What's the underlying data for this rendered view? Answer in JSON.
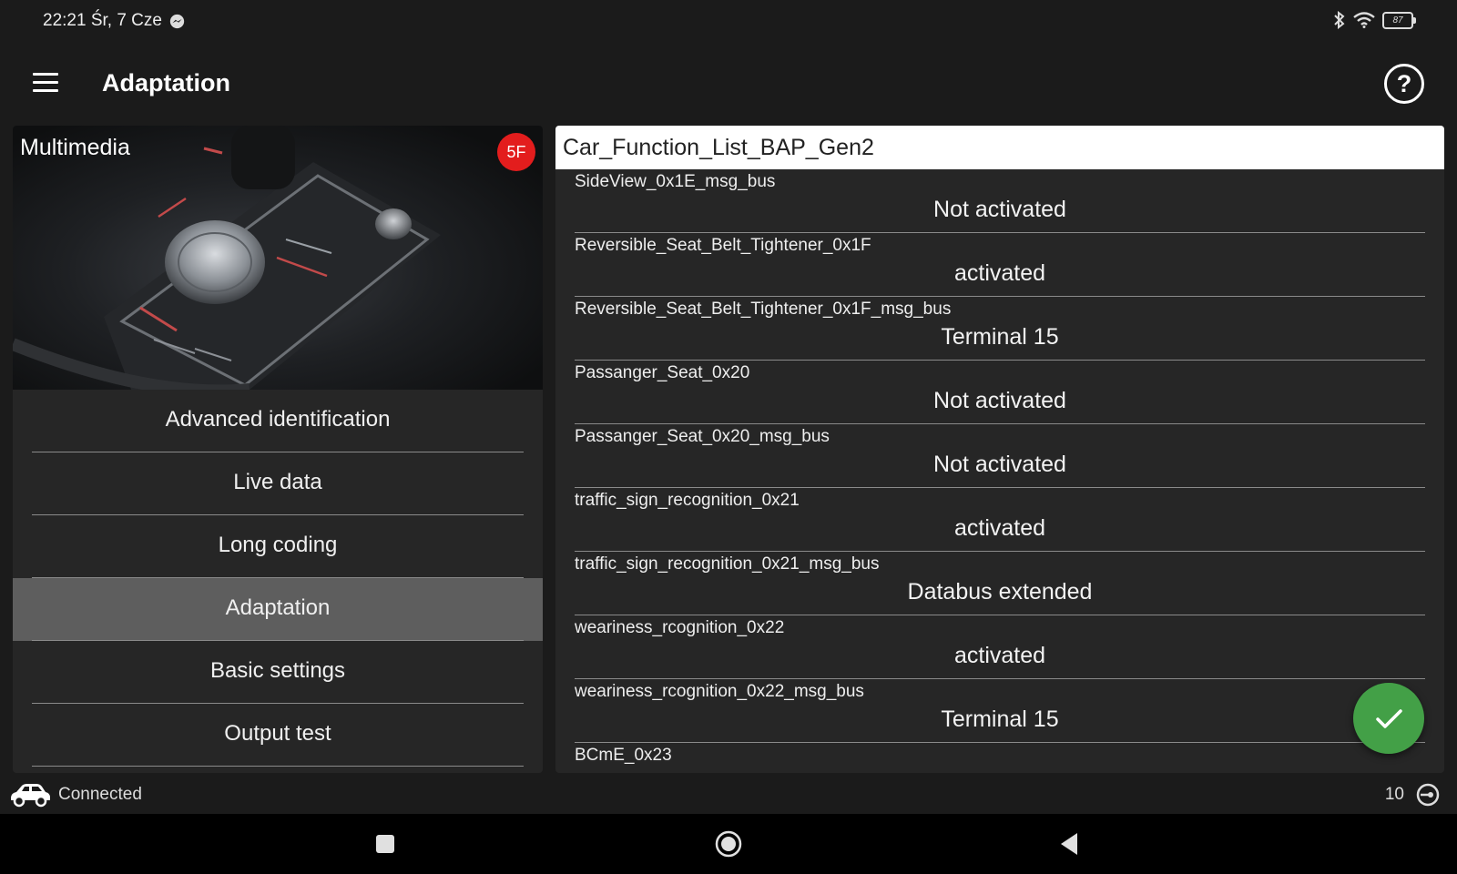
{
  "status_bar": {
    "time": "22:21 Śr, 7 Cze",
    "battery": "87",
    "icons": [
      "messenger-icon",
      "bluetooth-icon",
      "wifi-icon",
      "battery-icon"
    ]
  },
  "app_bar": {
    "title": "Adaptation",
    "help_label": "?"
  },
  "module": {
    "title": "Multimedia",
    "badge": "5F"
  },
  "menu": {
    "items": [
      {
        "label": "Advanced identification"
      },
      {
        "label": "Live data"
      },
      {
        "label": "Long coding"
      },
      {
        "label": "Adaptation",
        "active": true
      },
      {
        "label": "Basic settings"
      },
      {
        "label": "Output test"
      }
    ]
  },
  "adaptation": {
    "header": "Car_Function_List_BAP_Gen2",
    "rows": [
      {
        "name": "SideView_0x1E_msg_bus",
        "value": "Not activated"
      },
      {
        "name": "Reversible_Seat_Belt_Tightener_0x1F",
        "value": "activated"
      },
      {
        "name": "Reversible_Seat_Belt_Tightener_0x1F_msg_bus",
        "value": "Terminal 15"
      },
      {
        "name": "Passanger_Seat_0x20",
        "value": "Not activated"
      },
      {
        "name": "Passanger_Seat_0x20_msg_bus",
        "value": "Not activated"
      },
      {
        "name": "traffic_sign_recognition_0x21",
        "value": "activated"
      },
      {
        "name": "traffic_sign_recognition_0x21_msg_bus",
        "value": "Databus extended"
      },
      {
        "name": "weariness_rcognition_0x22",
        "value": "activated"
      },
      {
        "name": "weariness_rcognition_0x22_msg_bus",
        "value": "Terminal 15"
      },
      {
        "name": "BCmE_0x23",
        "value": ""
      }
    ]
  },
  "connection": {
    "status": "Connected",
    "count": "10"
  },
  "colors": {
    "background": "#1b1b1b",
    "panel": "#262626",
    "active_item": "#5e5e5e",
    "badge": "#e31d1d",
    "fab": "#43a047"
  }
}
